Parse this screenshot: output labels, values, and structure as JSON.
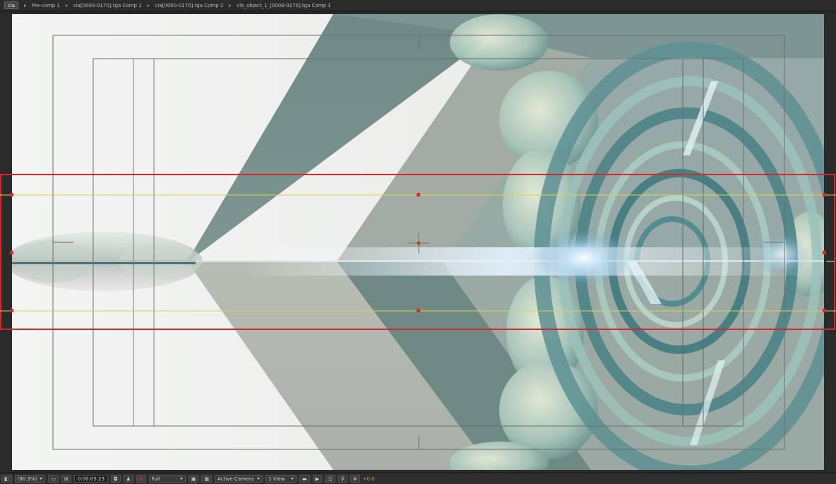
{
  "breadcrumbs": [
    {
      "label": "cia",
      "active": true
    },
    {
      "label": "Pre-comp 1",
      "active": false
    },
    {
      "label": "cia[0000-0170].tga Comp 1",
      "active": false
    },
    {
      "label": "cia[0000-0170].tga Comp 2",
      "active": false
    },
    {
      "label": "cib_object_1_[0000-0170].tga Comp 1",
      "active": false
    }
  ],
  "toolbar": {
    "magnification": "(90.3%)",
    "timecode": "0:00:05:23",
    "resolution": "Full",
    "camera": "Active Camera",
    "views": "1 View",
    "exposure": "+0.0"
  },
  "icons": {
    "region": "region-of-interest-icon",
    "grid": "grid-icon",
    "snapshot": "camera-snapshot-icon",
    "show_snapshot": "show-snapshot-icon",
    "channel": "rgb-channel-icon",
    "transparency": "transparency-grid-icon",
    "fast_preview": "fast-previews-icon",
    "timeline": "timeline-icon",
    "flowchart": "flowchart-icon",
    "exposure": "exposure-icon"
  },
  "colors": {
    "panel": "#2b2b2b",
    "selection_red": "#d22a2a",
    "guide_yellow": "#d8d83a",
    "exposure_orange": "#d39c3a"
  }
}
